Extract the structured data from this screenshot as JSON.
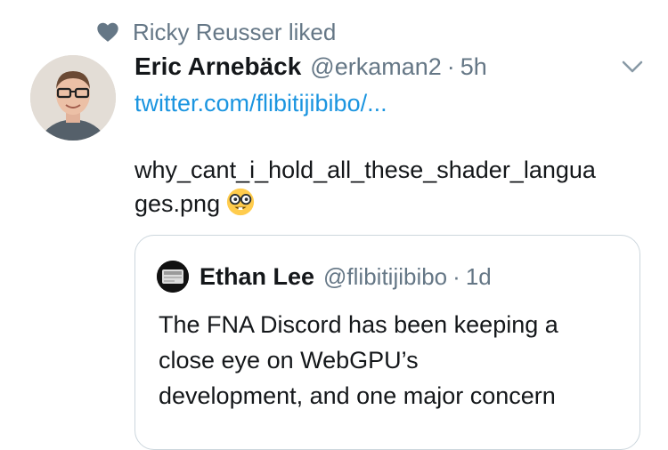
{
  "social_context": {
    "icon": "heart-icon",
    "text": "Ricky Reusser liked"
  },
  "tweet": {
    "author_name": "Eric Arnebäck",
    "handle": "@erkaman2",
    "separator": "·",
    "time": "5h",
    "link": "twitter.com/flibitijibibo/...",
    "text_line_1": "why_cant_i_hold_all_these_shader_langua",
    "text_line_2": "ges.png",
    "emoji": "nerd-face-emoji"
  },
  "quoted_tweet": {
    "author_name": "Ethan Lee",
    "handle": "@flibitijibibo",
    "separator": "·",
    "time": "1d",
    "lines": [
      "The FNA Discord has been keeping a",
      "close eye on WebGPU’s",
      "development, and one major concern"
    ]
  },
  "colors": {
    "text_primary": "#14171a",
    "text_secondary": "#657786",
    "link": "#1b95e0",
    "border": "#ccd6dd"
  }
}
